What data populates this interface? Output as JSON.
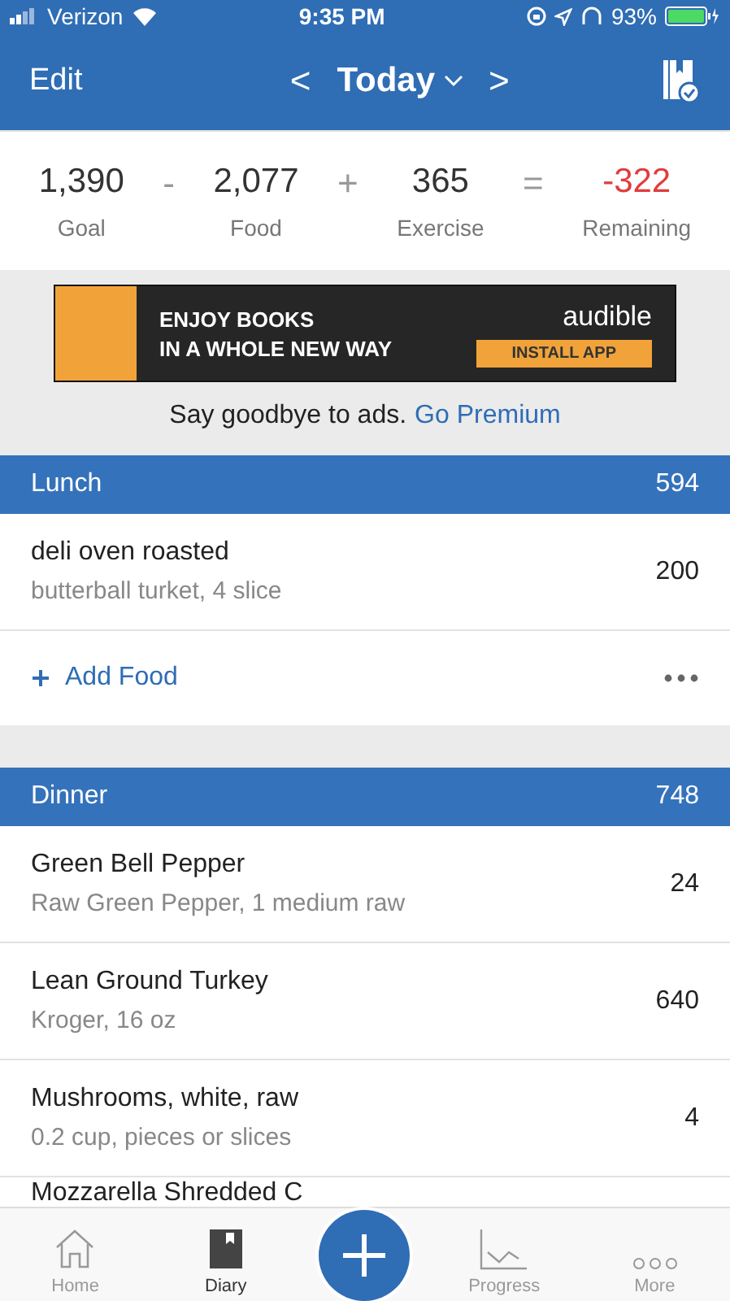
{
  "status_bar": {
    "carrier": "Verizon",
    "time": "9:35 PM",
    "battery": "93%"
  },
  "nav": {
    "edit": "Edit",
    "prev": "<",
    "title": "Today",
    "next": ">"
  },
  "summary": [
    {
      "kind": "value",
      "value": "1,390",
      "label": "Goal"
    },
    {
      "kind": "operator",
      "value": "-"
    },
    {
      "kind": "value",
      "value": "2,077",
      "label": "Food"
    },
    {
      "kind": "operator",
      "value": "+"
    },
    {
      "kind": "value",
      "value": "365",
      "label": "Exercise"
    },
    {
      "kind": "operator",
      "value": "="
    },
    {
      "kind": "negative",
      "value": "-322",
      "label": "Remaining"
    }
  ],
  "ad": {
    "headline": [
      "ENJOY BOOKS",
      "IN A WHOLE NEW WAY"
    ],
    "brand": "audible",
    "cta": "INSTALL APP"
  },
  "premium": {
    "text": "Say goodbye to ads.",
    "link": "Go Premium"
  },
  "meals": [
    {
      "name": "Lunch",
      "calories": "594",
      "add_food": "Add Food",
      "items": [
        {
          "name": "deli oven roasted",
          "detail": "butterball turket, 4 slice",
          "calories": "200"
        }
      ]
    },
    {
      "name": "Dinner",
      "calories": "748",
      "items": [
        {
          "name": "Green Bell Pepper",
          "detail": "Raw Green Pepper, 1 medium raw",
          "calories": "24"
        },
        {
          "name": "Lean Ground Turkey",
          "detail": "Kroger, 16 oz",
          "calories": "640"
        },
        {
          "name": "Mushrooms, white, raw",
          "detail": "0.2 cup, pieces or slices",
          "calories": "4"
        },
        {
          "name": "Mozzarella Shredded C"
        }
      ]
    }
  ],
  "tabs": [
    {
      "label": "Home",
      "selected": false
    },
    {
      "label": "Diary",
      "selected": true
    },
    {
      "label": "Progress",
      "selected": false
    },
    {
      "label": "More",
      "selected": false
    }
  ]
}
